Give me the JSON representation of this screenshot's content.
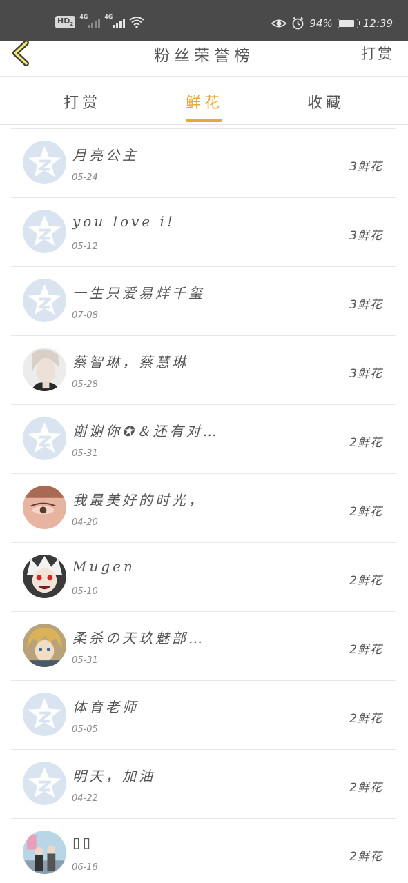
{
  "status_bar": {
    "hd_label": "HD",
    "sim_label": "2",
    "net1_label": "4G",
    "net2_label": "4G",
    "icons": [
      "eye-icon",
      "alarm-icon",
      "wifi-icon",
      "battery-icon"
    ],
    "battery_percent": "94%",
    "battery_level": 0.94,
    "time": "12:39"
  },
  "header": {
    "title": "粉丝荣誉榜",
    "action": "打赏"
  },
  "tabs": [
    {
      "label": "打赏",
      "active": false
    },
    {
      "label": "鲜花",
      "active": true
    },
    {
      "label": "收藏",
      "active": false
    }
  ],
  "accent_color": "#e8a83a",
  "fans": [
    {
      "name": "月亮公主",
      "date": "05-24",
      "count": "3鲜花",
      "avatar": "default-qzone"
    },
    {
      "name": "you love i!",
      "date": "05-12",
      "count": "3鲜花",
      "avatar": "default-qzone"
    },
    {
      "name": "一生只爱易烊千玺",
      "date": "07-08",
      "count": "3鲜花",
      "avatar": "default-qzone"
    },
    {
      "name": "蔡智琳，蔡慧琳",
      "date": "05-28",
      "count": "3鲜花",
      "avatar": "photo-man"
    },
    {
      "name": "谢谢你✪＆还有对…",
      "date": "05-31",
      "count": "2鲜花",
      "avatar": "default-qzone"
    },
    {
      "name": "我最美好的时光，",
      "date": "04-20",
      "count": "2鲜花",
      "avatar": "photo-eye"
    },
    {
      "name": "Mugen",
      "date": "05-10",
      "count": "2鲜花",
      "avatar": "photo-anime-red"
    },
    {
      "name": "柔杀の天玖魅部…",
      "date": "05-31",
      "count": "2鲜花",
      "avatar": "photo-anime-blond"
    },
    {
      "name": "体育老师",
      "date": "05-05",
      "count": "2鲜花",
      "avatar": "default-qzone"
    },
    {
      "name": "明天，加油",
      "date": "04-22",
      "count": "2鲜花",
      "avatar": "default-qzone"
    },
    {
      "name": "▯▯",
      "date": "06-18",
      "count": "2鲜花",
      "avatar": "photo-couple"
    }
  ]
}
